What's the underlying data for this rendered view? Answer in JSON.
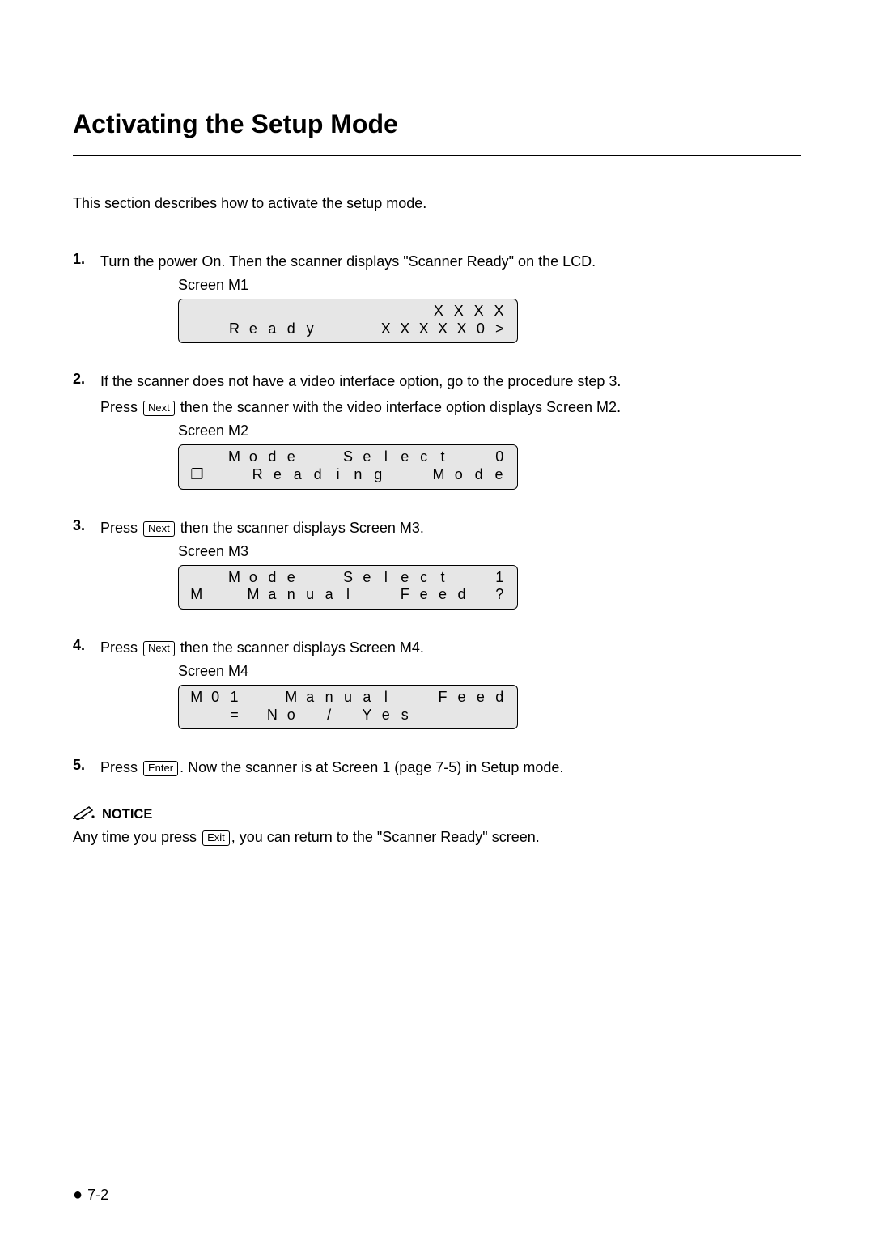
{
  "title": "Activating the Setup Mode",
  "intro": "This section describes how to activate the setup mode.",
  "steps": [
    {
      "n": "1.",
      "text": "Turn the power On. Then the scanner displays \"Scanner Ready\" on the LCD.",
      "screen_label": "Screen M1",
      "lcd": {
        "row1": [
          " ",
          " ",
          " ",
          " ",
          " ",
          " ",
          " ",
          " ",
          " ",
          " ",
          " ",
          " ",
          "X",
          "X",
          "X",
          "X"
        ],
        "row2": [
          " ",
          " ",
          "R",
          "e",
          "a",
          "d",
          "y",
          " ",
          " ",
          " ",
          "X",
          "X",
          "X",
          "X",
          "X",
          "0",
          ">"
        ]
      }
    },
    {
      "n": "2.",
      "text_a": "If the scanner does not have a video interface option, go to the procedure step 3.",
      "text_b_pre": "Press ",
      "key_b": "Next",
      "text_b_post": " then the scanner with the video interface option displays Screen M2.",
      "screen_label": "Screen M2",
      "lcd": {
        "row1": [
          " ",
          " ",
          "M",
          "o",
          "d",
          "e",
          " ",
          " ",
          "S",
          "e",
          "l",
          "e",
          "c",
          "t",
          " ",
          " ",
          "0"
        ],
        "row2": [
          "❐",
          " ",
          " ",
          "R",
          "e",
          "a",
          "d",
          "i",
          "n",
          "g",
          " ",
          " ",
          "M",
          "o",
          "d",
          "e"
        ]
      }
    },
    {
      "n": "3.",
      "text_pre": "Press ",
      "key": "Next",
      "text_post": " then the scanner displays Screen M3.",
      "screen_label": "Screen M3",
      "lcd": {
        "row1": [
          " ",
          " ",
          "M",
          "o",
          "d",
          "e",
          " ",
          " ",
          "S",
          "e",
          "l",
          "e",
          "c",
          "t",
          " ",
          " ",
          "1"
        ],
        "row2": [
          "M",
          " ",
          " ",
          "M",
          "a",
          "n",
          "u",
          "a",
          "l",
          " ",
          " ",
          "F",
          "e",
          "e",
          "d",
          " ",
          "?"
        ]
      }
    },
    {
      "n": "4.",
      "text_pre": "Press ",
      "key": "Next",
      "text_post": " then the scanner displays Screen M4.",
      "screen_label": "Screen M4",
      "lcd": {
        "row1": [
          "M",
          "0",
          "1",
          " ",
          " ",
          "M",
          "a",
          "n",
          "u",
          "a",
          "l",
          " ",
          " ",
          "F",
          "e",
          "e",
          "d"
        ],
        "row2": [
          " ",
          " ",
          "=",
          " ",
          "N",
          "o",
          " ",
          "/",
          " ",
          "Y",
          "e",
          "s",
          " ",
          " ",
          " ",
          " ",
          " "
        ]
      }
    },
    {
      "n": "5.",
      "text_pre": "Press ",
      "key": "Enter",
      "text_post": ". Now the scanner is at Screen 1 (page 7-5) in Setup mode."
    }
  ],
  "notice": {
    "label": "NOTICE",
    "text_pre": "Any time you press ",
    "key": "Exit",
    "text_post": ", you can return to the \"Scanner Ready\" screen."
  },
  "footer": "7-2"
}
